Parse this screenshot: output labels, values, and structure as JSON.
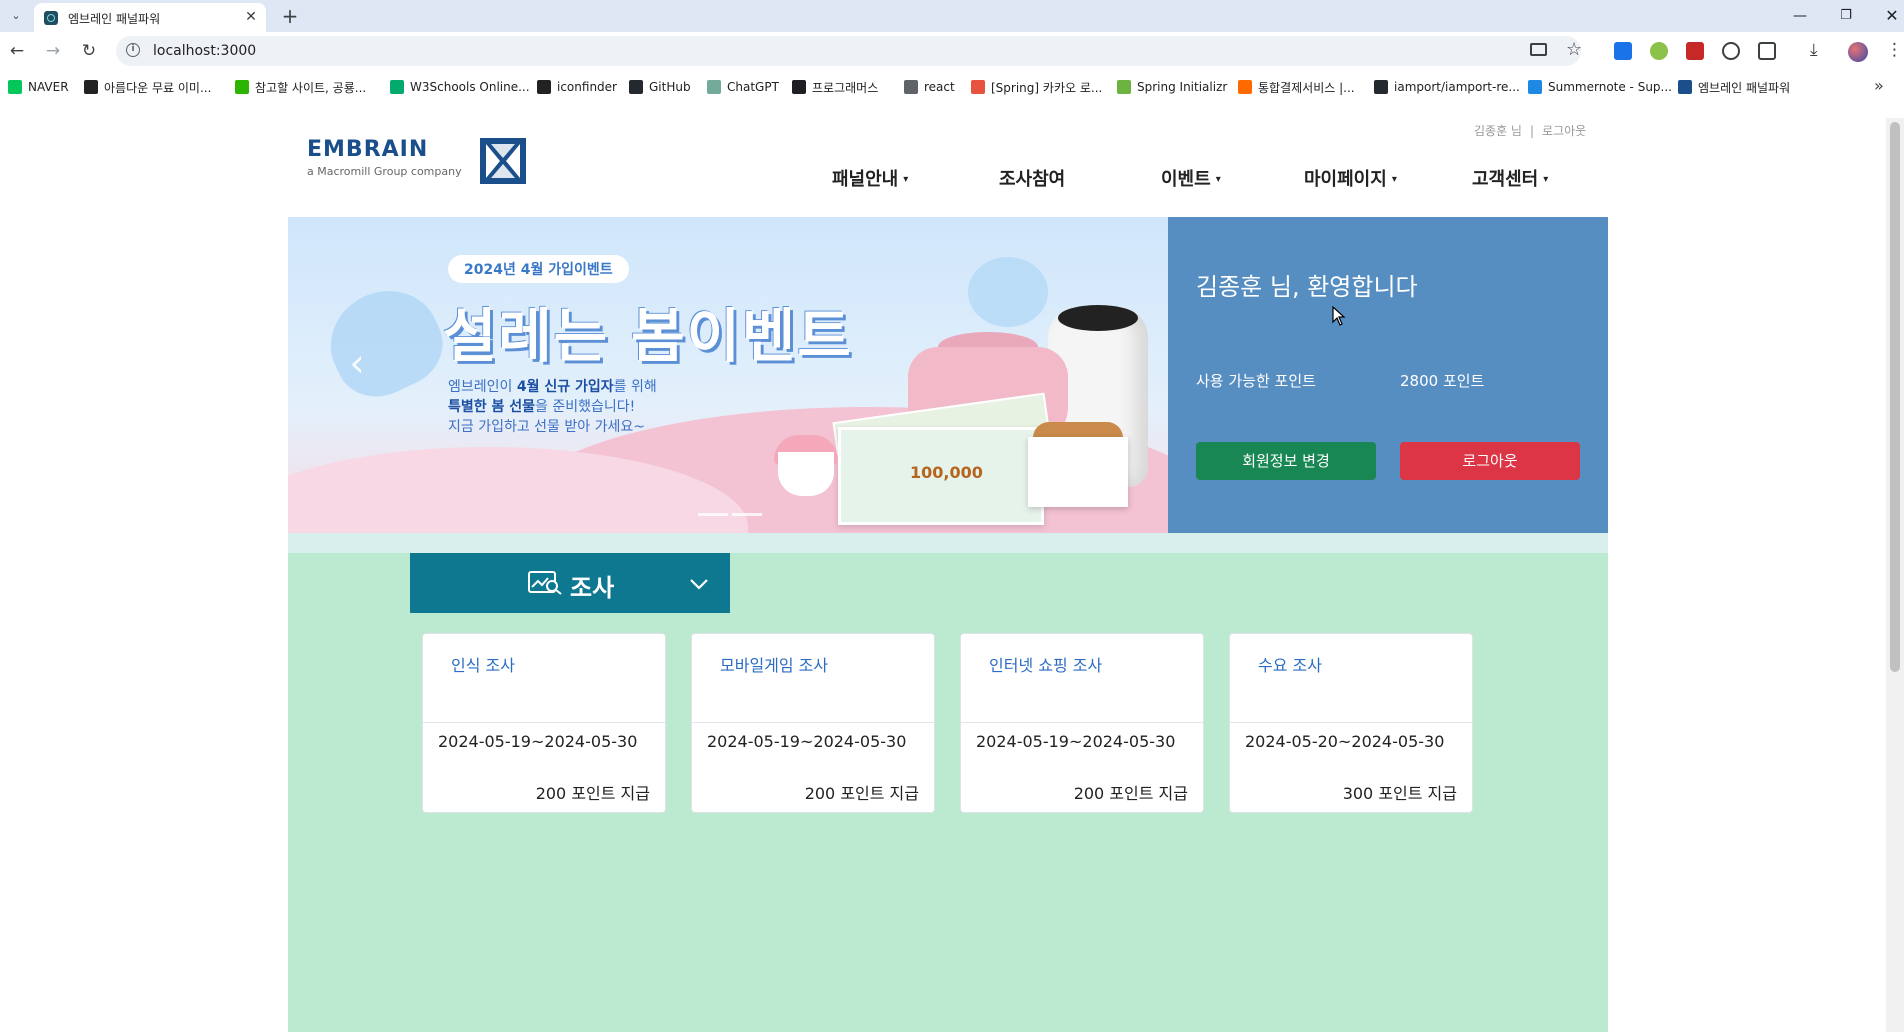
{
  "browser": {
    "tab_title": "엠브레인 패널파워",
    "url": "localhost:3000",
    "bookmarks": [
      {
        "label": "NAVER",
        "color": "#03c75a"
      },
      {
        "label": "아름다운 무료 이미...",
        "color": "#222222"
      },
      {
        "label": "참고할 사이트, 공룡...",
        "color": "#2db400"
      },
      {
        "label": "W3Schools Online...",
        "color": "#04aa6d"
      },
      {
        "label": "iconfinder",
        "color": "#222222"
      },
      {
        "label": "GitHub",
        "color": "#24292f"
      },
      {
        "label": "ChatGPT",
        "color": "#74aa9c"
      },
      {
        "label": "프로그래머스",
        "color": "#1e1e23"
      },
      {
        "label": "react",
        "color": "#5f6368"
      },
      {
        "label": "[Spring] 카카오 로...",
        "color": "#e8533f"
      },
      {
        "label": "Spring Initializr",
        "color": "#6db33f"
      },
      {
        "label": "통합결제서비스 |...",
        "color": "#ff6a00"
      },
      {
        "label": "iamport/iamport-re...",
        "color": "#24292f"
      },
      {
        "label": "Summernote - Sup...",
        "color": "#1e88e5"
      },
      {
        "label": "엠브레인 패널파워",
        "color": "#1b4f8c"
      }
    ]
  },
  "header": {
    "user_name": "김종훈 님",
    "separator": "|",
    "logout_link": "로그아웃",
    "logo_text": "EMBRAIN",
    "logo_sub": "a Macromill Group company",
    "menu": [
      {
        "label": "패널안내",
        "caret": "▾"
      },
      {
        "label": "조사참여",
        "caret": ""
      },
      {
        "label": "이벤트",
        "caret": "▾"
      },
      {
        "label": "마이페이지",
        "caret": "▾"
      },
      {
        "label": "고객센터",
        "caret": "▾"
      }
    ]
  },
  "banner": {
    "badge": "2024년 4월 가입이벤트",
    "title": "설레는 봄이벤트",
    "desc_prefix": "엠브레인이 ",
    "desc_bold1": "4월 신규 가입자",
    "desc_mid": "를 위해",
    "desc_bold2": "특별한 봄 선물",
    "desc_mid2": "을 준비했습니다!",
    "desc_line3": "지금 가입하고 선물 받아 가세요~",
    "ticket_text": "100,000"
  },
  "welcome": {
    "title": "김종훈 님, 환영합니다",
    "points_label": "사용 가능한 포인트",
    "points_value": "2800 포인트",
    "edit_button": "회원정보 변경",
    "logout_button": "로그아웃"
  },
  "surveys": {
    "toggle_label": "조사",
    "items": [
      {
        "title": "인식 조사",
        "period": "2024-05-19~2024-05-30",
        "reward": "200 포인트 지급"
      },
      {
        "title": "모바일게임 조사",
        "period": "2024-05-19~2024-05-30",
        "reward": "200 포인트 지급"
      },
      {
        "title": "인터넷 쇼핑 조사",
        "period": "2024-05-19~2024-05-30",
        "reward": "200 포인트 지급"
      },
      {
        "title": "수요 조사",
        "period": "2024-05-20~2024-05-30",
        "reward": "300 포인트 지급"
      }
    ]
  },
  "colors": {
    "welcome_bg": "#578ec2",
    "survey_bg": "#bbead1",
    "toggle_bg": "#0f7891",
    "edit_btn": "#198754",
    "logout_btn": "#dc3545",
    "logo": "#1b4f8c"
  }
}
